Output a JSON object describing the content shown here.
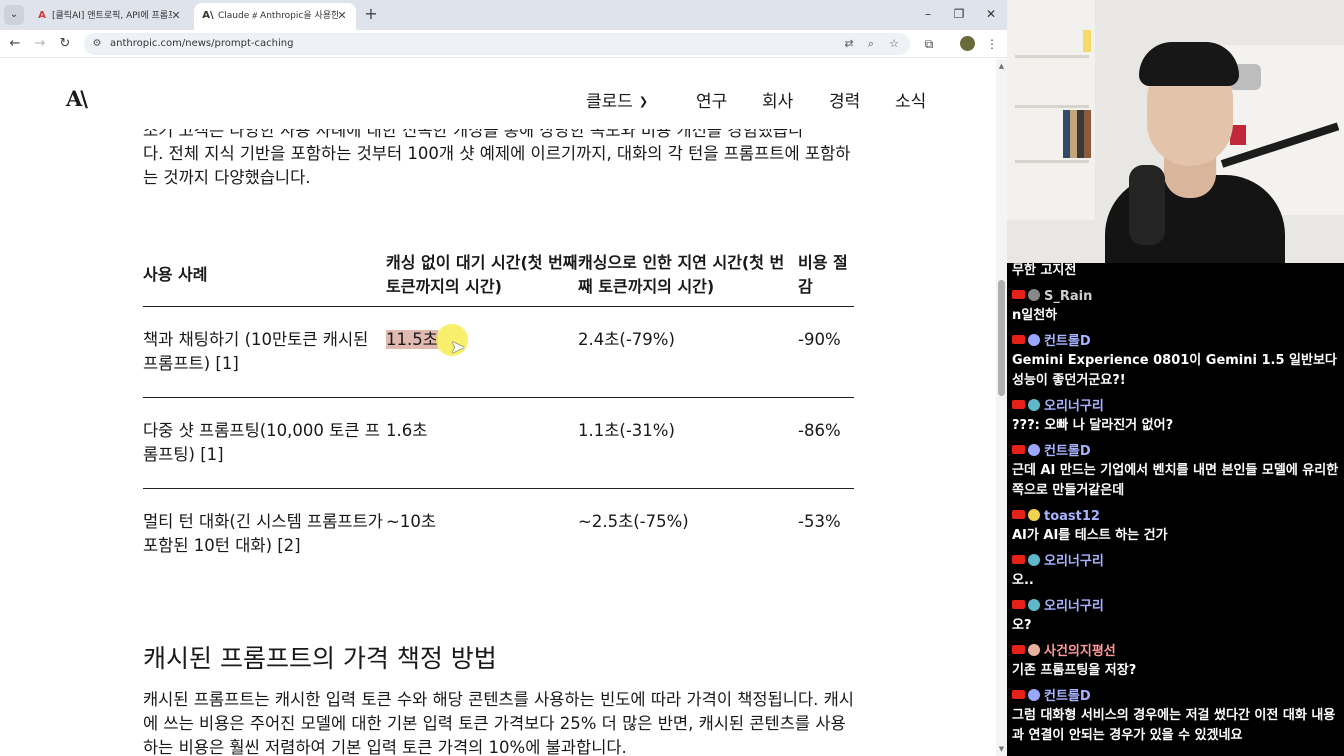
{
  "browser": {
    "tabs": [
      {
        "title": "[클릭AI] 앤트로픽, API에 프롬프트",
        "favicon": "A"
      },
      {
        "title": "Claude ⧣ Anthropic을 사용한",
        "favicon": "A\\"
      }
    ],
    "url": "anthropic.com/news/prompt-caching"
  },
  "site": {
    "logo": "A\\",
    "nav": [
      "클로드",
      "연구",
      "회사",
      "경력",
      "소식"
    ]
  },
  "article": {
    "intro_clipped": "조기 고객은 다양한 사용 사례에 대한 신속한 캐싱을 통해 상당한 속도와 비용 개선을 경험했습니",
    "intro": "다. 전체 지식 기반을 포함하는 것부터 100개 샷 예제에 이르기까지, 대화의 각 턴을 프롬프트에 포함하는 것까지 다양했습니다.",
    "table": {
      "headers": [
        "사용 사례",
        "캐싱 없이 대기 시간(첫 번째 토큰까지의 시간)",
        "캐싱으로 인한 지연 시간(첫 번째 토큰까지의 시간)",
        "비용 절감"
      ],
      "rows": [
        [
          "책과 채팅하기 (10만토큰 캐시된 프롬프트) [1]",
          "11.5초",
          "2.4초(-79%)",
          "-90%"
        ],
        [
          "다중 샷 프롬프팅(10,000 토큰 프롬프팅) [1]",
          "1.6초",
          "1.1초(-31%)",
          "-86%"
        ],
        [
          "멀티 턴 대화(긴 시스템 프롬프트가 포함된 10턴 대화) [2]",
          "~10초",
          "~2.5초(-75%)",
          "-53%"
        ]
      ]
    },
    "section_heading": "캐시된 프롬프트의 가격 책정 방법",
    "paragraph": "캐시된 프롬프트는 캐시한 입력 토큰 수와 해당 콘텐츠를 사용하는 빈도에 따라 가격이 책정됩니다. 캐시에 쓰는 비용은 주어진 모델에 대한 기본 입력 토큰 가격보다 25% 더 많은 반면, 캐시된 콘텐츠를 사용하는 비용은 훨씬 저렴하여 기본 입력 토큰 가격의 10%에 불과합니다."
  },
  "chat": {
    "messages": [
      {
        "user": "",
        "text": "무한 고지전"
      },
      {
        "user": "S_Rain",
        "color": "#cfcfcf",
        "badge": "#888888",
        "text": "n일천하"
      },
      {
        "user": "컨트롤D",
        "color": "#a8b4ff",
        "badge": "#9aa6ff",
        "text": "Gemini Experience 0801이 Gemini 1.5 일반보다 성능이 좋던거군요?!"
      },
      {
        "user": "오리너구리",
        "color": "#a8b4ff",
        "badge": "#5fb8c8",
        "text": "???: 오빠 나 달라진거 없어?"
      },
      {
        "user": "컨트롤D",
        "color": "#a8b4ff",
        "badge": "#9aa6ff",
        "text": "근데 AI 만드는 기업에서 벤치를 내면 본인들 모델에 유리한 쪽으로 만들거같은데"
      },
      {
        "user": "toast12",
        "color": "#a8b4ff",
        "badge": "#f2d34f",
        "text": "AI가 AI를 테스트 하는 건가"
      },
      {
        "user": "오리너구리",
        "color": "#a8b4ff",
        "badge": "#5fb8c8",
        "text": "오.."
      },
      {
        "user": "오리너구리",
        "color": "#a8b4ff",
        "badge": "#5fb8c8",
        "text": "오?"
      },
      {
        "user": "사건의지평선",
        "color": "#ff9a9a",
        "badge": "#e8b0a0",
        "text": "기존 프롬프팅을 저장?"
      },
      {
        "user": "컨트롤D",
        "color": "#a8b4ff",
        "badge": "#9aa6ff",
        "text": "그럼 대화형 서비스의 경우에는 저걸 썼다간 이전 대화 내용과 연결이 안되는 경우가 있을 수 있겠네요"
      }
    ]
  }
}
